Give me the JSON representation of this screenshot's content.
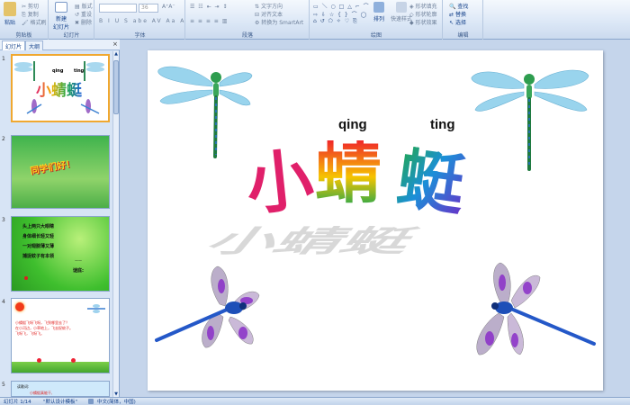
{
  "ribbon": {
    "clipboard": {
      "paste": "粘贴",
      "cut": "剪切",
      "copy": "复制",
      "format_painter": "格式刷",
      "label": "剪贴板"
    },
    "slides": {
      "new_slide": "新建",
      "new_slide2": "幻灯片",
      "layout": "版式",
      "reset": "重设",
      "delete": "删除",
      "label": "幻灯片"
    },
    "font": {
      "size": "36",
      "label": "字体"
    },
    "paragraph": {
      "text_direction": "文字方向",
      "align_text": "对齐文本",
      "smartart": "转换为 SmartArt",
      "label": "段落"
    },
    "drawing": {
      "arrange": "排列",
      "quick_styles": "快速样式",
      "shape_fill": "形状填充",
      "shape_outline": "形状轮廓",
      "shape_effects": "形状效果",
      "label": "绘图"
    },
    "editing": {
      "find": "查找",
      "replace": "替换",
      "select": "选择",
      "label": "编辑"
    }
  },
  "pane": {
    "tab_slides": "幻灯片",
    "tab_outline": "大纲"
  },
  "thumbs": [
    {
      "num": "1",
      "title": "小蜻蜓",
      "pin1": "qing",
      "pin2": "ting"
    },
    {
      "num": "2",
      "text": "同学们好！"
    },
    {
      "num": "3",
      "lines": [
        "头上两只大眼睛",
        "身体细长轻又轻",
        "一对翅膀薄又薄",
        "捕捉蚊子有本领"
      ],
      "answer": "谜底:",
      "dash": "——"
    },
    {
      "num": "4",
      "lines": [
        "小蜻蜓飞呀飞呀，飞到哪里去了？",
        "在小河边，小草地上，飞去捉蚊子。",
        "飞呀飞，飞呀飞。"
      ]
    },
    {
      "num": "5",
      "lines": [
        "读歌词:",
        "小蜻蜓真能干,"
      ]
    }
  ],
  "slide": {
    "pinyin1": "qing",
    "pinyin2": "ting",
    "char1": "小",
    "char2": "蜻",
    "char3": "蜓"
  },
  "status": {
    "page": "幻灯片 1/14",
    "theme": "\"默认设计模板\"",
    "lang": "中文(简体，中国)"
  }
}
